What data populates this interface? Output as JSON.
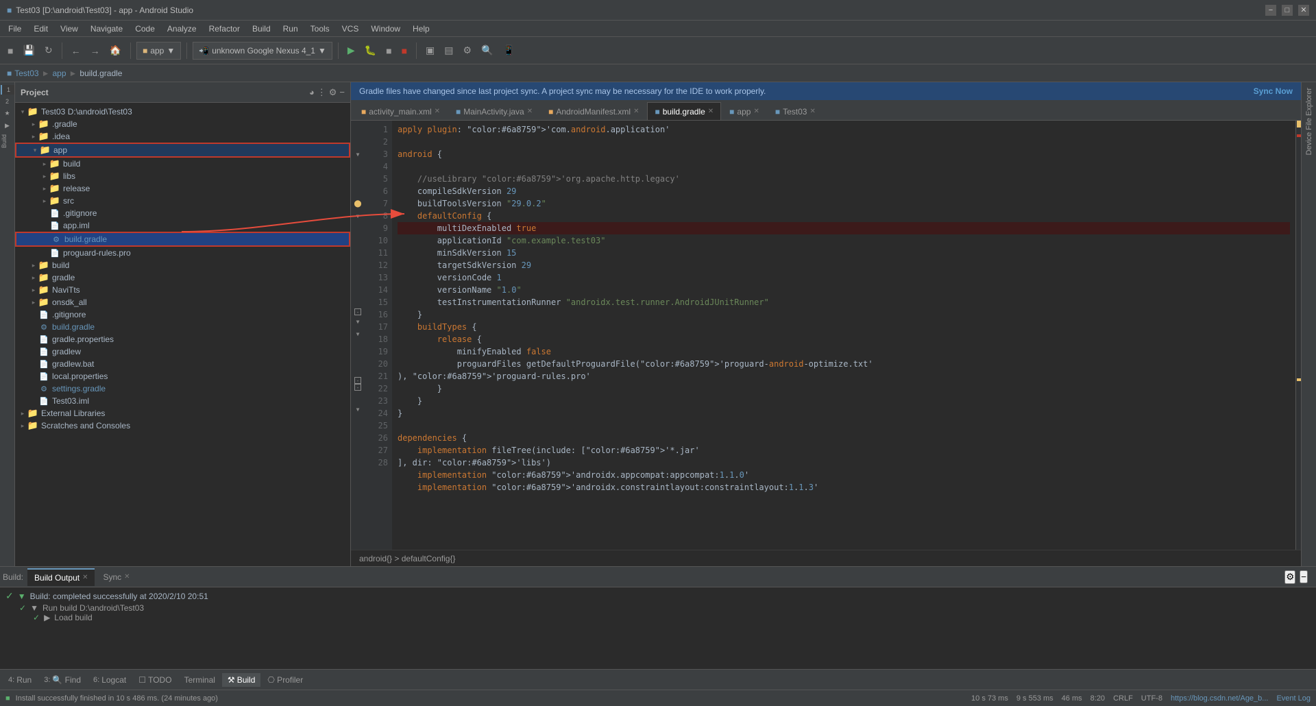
{
  "window": {
    "title": "Test03 [D:\\android\\Test03] - app - Android Studio"
  },
  "menu": {
    "items": [
      "File",
      "Edit",
      "View",
      "Navigate",
      "Code",
      "Analyze",
      "Refactor",
      "Build",
      "Run",
      "Tools",
      "VCS",
      "Window",
      "Help"
    ]
  },
  "toolbar": {
    "app_dropdown": "app",
    "device_selector": "unknown Google Nexus 4_1",
    "device_selector_icon": "▼"
  },
  "breadcrumb": {
    "parts": [
      "Test03",
      "app",
      "build.gradle"
    ]
  },
  "project_panel": {
    "title": "Project",
    "tree": [
      {
        "id": "test03-root",
        "label": "Test03  D:\\android\\Test03",
        "indent": 0,
        "type": "root",
        "expanded": true
      },
      {
        "id": "gradle-folder",
        "label": ".gradle",
        "indent": 1,
        "type": "folder",
        "expanded": false
      },
      {
        "id": "idea-folder",
        "label": ".idea",
        "indent": 1,
        "type": "folder",
        "expanded": false
      },
      {
        "id": "app-folder",
        "label": "app",
        "indent": 1,
        "type": "folder",
        "expanded": true,
        "highlighted": true
      },
      {
        "id": "build-folder-app",
        "label": "build",
        "indent": 2,
        "type": "folder",
        "expanded": false
      },
      {
        "id": "libs-folder",
        "label": "libs",
        "indent": 2,
        "type": "folder",
        "expanded": false
      },
      {
        "id": "release-folder",
        "label": "release",
        "indent": 2,
        "type": "folder",
        "expanded": false
      },
      {
        "id": "src-folder",
        "label": "src",
        "indent": 2,
        "type": "folder",
        "expanded": false
      },
      {
        "id": "gitignore-app",
        "label": ".gitignore",
        "indent": 2,
        "type": "file"
      },
      {
        "id": "app-iml",
        "label": "app.iml",
        "indent": 2,
        "type": "file"
      },
      {
        "id": "build-gradle-app",
        "label": "build.gradle",
        "indent": 2,
        "type": "gradle",
        "selected": true
      },
      {
        "id": "proguard",
        "label": "proguard-rules.pro",
        "indent": 2,
        "type": "file"
      },
      {
        "id": "build-root",
        "label": "build",
        "indent": 1,
        "type": "folder",
        "expanded": false
      },
      {
        "id": "gradle-root",
        "label": "gradle",
        "indent": 1,
        "type": "folder",
        "expanded": false
      },
      {
        "id": "navitts",
        "label": "NaviTts",
        "indent": 1,
        "type": "folder",
        "expanded": false
      },
      {
        "id": "onsdk",
        "label": "onsdk_all",
        "indent": 1,
        "type": "folder",
        "expanded": false
      },
      {
        "id": "gitignore-root",
        "label": ".gitignore",
        "indent": 1,
        "type": "file"
      },
      {
        "id": "build-gradle-root",
        "label": "build.gradle",
        "indent": 1,
        "type": "gradle"
      },
      {
        "id": "gradle-properties",
        "label": "gradle.properties",
        "indent": 1,
        "type": "file"
      },
      {
        "id": "gradlew",
        "label": "gradlew",
        "indent": 1,
        "type": "file"
      },
      {
        "id": "gradlew-bat",
        "label": "gradlew.bat",
        "indent": 1,
        "type": "file"
      },
      {
        "id": "local-properties",
        "label": "local.properties",
        "indent": 1,
        "type": "file"
      },
      {
        "id": "settings-gradle",
        "label": "settings.gradle",
        "indent": 1,
        "type": "gradle"
      },
      {
        "id": "test03-iml",
        "label": "Test03.iml",
        "indent": 1,
        "type": "file"
      },
      {
        "id": "external-libs",
        "label": "External Libraries",
        "indent": 0,
        "type": "folder",
        "expanded": false
      },
      {
        "id": "scratches",
        "label": "Scratches and Consoles",
        "indent": 0,
        "type": "folder",
        "expanded": false
      }
    ]
  },
  "editor": {
    "tabs": [
      {
        "id": "activity-main",
        "label": "activity_main.xml",
        "icon": "xml",
        "active": false
      },
      {
        "id": "main-activity",
        "label": "MainActivity.java",
        "icon": "java",
        "active": false
      },
      {
        "id": "android-manifest",
        "label": "AndroidManifest.xml",
        "icon": "xml",
        "active": false
      },
      {
        "id": "app-tab",
        "label": "app",
        "icon": "gradle",
        "active": false
      },
      {
        "id": "test03-tab",
        "label": "Test03",
        "icon": "gradle",
        "active": false
      }
    ],
    "active_tab": "build-gradle-app",
    "active_tab_label": "build.gradle",
    "code_lines": [
      {
        "num": 1,
        "code": "apply plugin: 'com.android.application'",
        "type": "normal"
      },
      {
        "num": 2,
        "code": "",
        "type": "normal"
      },
      {
        "num": 3,
        "code": "android {",
        "type": "fold"
      },
      {
        "num": 4,
        "code": "",
        "type": "normal"
      },
      {
        "num": 5,
        "code": "    //useLibrary 'org.apache.http.legacy'",
        "type": "comment"
      },
      {
        "num": 6,
        "code": "    compileSdkVersion 29",
        "type": "normal"
      },
      {
        "num": 7,
        "code": "    buildToolsVersion \"29.0.2\"",
        "type": "warn"
      },
      {
        "num": 8,
        "code": "    defaultConfig {",
        "type": "fold"
      },
      {
        "num": 9,
        "code": "        multiDexEnabled true",
        "type": "highlight"
      },
      {
        "num": 10,
        "code": "        applicationId \"com.example.test03\"",
        "type": "normal"
      },
      {
        "num": 11,
        "code": "        minSdkVersion 15",
        "type": "normal"
      },
      {
        "num": 12,
        "code": "        targetSdkVersion 29",
        "type": "normal"
      },
      {
        "num": 13,
        "code": "        versionCode 1",
        "type": "normal"
      },
      {
        "num": 14,
        "code": "        versionName \"1.0\"",
        "type": "normal"
      },
      {
        "num": 15,
        "code": "        testInstrumentationRunner \"androidx.test.runner.AndroidJUnitRunner\"",
        "type": "normal"
      },
      {
        "num": 16,
        "code": "    }",
        "type": "fold"
      },
      {
        "num": 17,
        "code": "    buildTypes {",
        "type": "fold"
      },
      {
        "num": 18,
        "code": "        release {",
        "type": "fold"
      },
      {
        "num": 19,
        "code": "            minifyEnabled false",
        "type": "normal"
      },
      {
        "num": 20,
        "code": "            proguardFiles getDefaultProguardFile('proguard-android-optimize.txt'), 'proguard-rules.pro'",
        "type": "normal"
      },
      {
        "num": 21,
        "code": "        }",
        "type": "normal"
      },
      {
        "num": 22,
        "code": "    }",
        "type": "fold"
      },
      {
        "num": 23,
        "code": "}",
        "type": "fold"
      },
      {
        "num": 24,
        "code": "",
        "type": "normal"
      },
      {
        "num": 25,
        "code": "dependencies {",
        "type": "fold"
      },
      {
        "num": 26,
        "code": "    implementation fileTree(include: ['*.jar'], dir: 'libs')",
        "type": "normal"
      },
      {
        "num": 27,
        "code": "    implementation 'androidx.appcompat:appcompat:1.1.0'",
        "type": "normal"
      },
      {
        "num": 28,
        "code": "    implementation 'androidx.constraintlayout:constraintlayout:1.1.3'",
        "type": "normal"
      }
    ],
    "bottom_breadcrumb": "android{} > defaultConfig{}"
  },
  "sync_bar": {
    "message": "Gradle files have changed since last project sync. A project sync may be necessary for the IDE to work properly.",
    "action": "Sync Now"
  },
  "bottom_panel": {
    "tabs": [
      {
        "id": "build-tab",
        "label": "Build Output",
        "active": true
      },
      {
        "id": "sync-tab",
        "label": "Sync",
        "active": false
      }
    ],
    "build_label": "Build:",
    "build_content": {
      "main": "Build: completed successfully at 2020/2/10 20:51",
      "sub1": "Run build D:\\android\\Test03",
      "sub2": "Load build"
    }
  },
  "bottom_toolbar": {
    "buttons": [
      {
        "id": "run",
        "label": "Run",
        "num": "4",
        "active": false
      },
      {
        "id": "find",
        "label": "Find",
        "num": "3",
        "active": false
      },
      {
        "id": "logcat",
        "label": "Logcat",
        "num": "6",
        "active": false
      },
      {
        "id": "todo",
        "label": "TODO",
        "num": "",
        "active": false
      },
      {
        "id": "terminal",
        "label": "Terminal",
        "num": "",
        "active": false
      },
      {
        "id": "build",
        "label": "Build",
        "num": "",
        "active": true
      },
      {
        "id": "profiler",
        "label": "Profiler",
        "num": "",
        "active": false
      }
    ]
  },
  "status_bar": {
    "message": "Install successfully finished in 10 s 486 ms. (24 minutes ago)",
    "position": "8:20",
    "encoding": "CRLF",
    "charset": "UTF-8",
    "url": "https://blog.csdn.net/Age_b...",
    "event_log": "Event Log",
    "stats": [
      "10 s 73 ms",
      "9 s 553 ms",
      "46 ms"
    ]
  },
  "annotation": {
    "red_box_line": 9,
    "red_box_text": "multiDexEnabled true",
    "source_file": "build.gradle",
    "source_label": "build.gradle (highlighted in tree)"
  }
}
